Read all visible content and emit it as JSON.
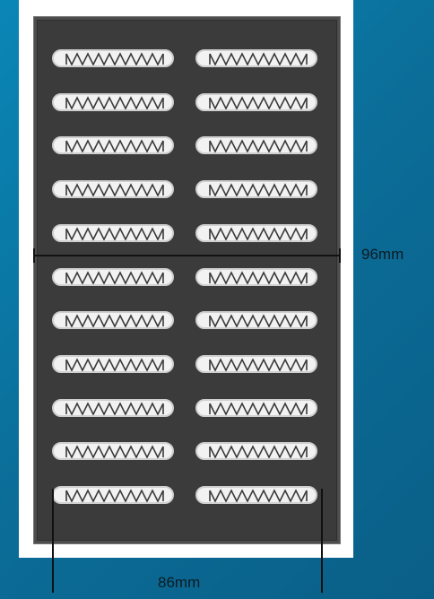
{
  "figure": {
    "type": "vent-plate-drawing",
    "rows": 11,
    "columns": 2,
    "dimensions": {
      "height_label": "96mm",
      "width_label": "86mm"
    },
    "colors": {
      "background": "#0b6d98",
      "plate": "#3b3b3b",
      "slot": "#f2f2f2",
      "dimension_line": "#111111"
    }
  }
}
